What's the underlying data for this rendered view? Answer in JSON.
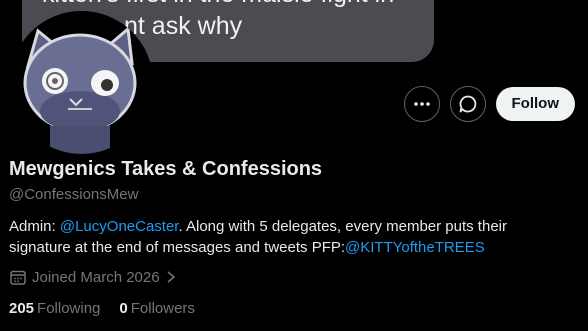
{
  "banner": {
    "line1": "kitten's first in the maisie fight in",
    "line2": "nt ask why"
  },
  "profile": {
    "display_name": "Mewgenics Takes & Confessions",
    "handle": "@ConfessionsMew",
    "bio_prefix": "Admin: ",
    "bio_admin_link": "@LucyOneCaster",
    "bio_middle": ". Along with 5 delegates, every member puts their signature at the end of messages and tweets PFP:",
    "bio_pfp_link": "@KITTYoftheTREES",
    "joined": "Joined March 2026",
    "following_count": "205",
    "following_label": "Following",
    "followers_count": "0",
    "followers_label": "Followers"
  },
  "actions": {
    "more_icon": "more-dots-icon",
    "message_icon": "message-icon",
    "follow_label": "Follow"
  },
  "colors": {
    "background": "#000000",
    "link": "#1d9bf0",
    "secondary_text": "#71767b",
    "follow_bg": "#eff3f4"
  }
}
